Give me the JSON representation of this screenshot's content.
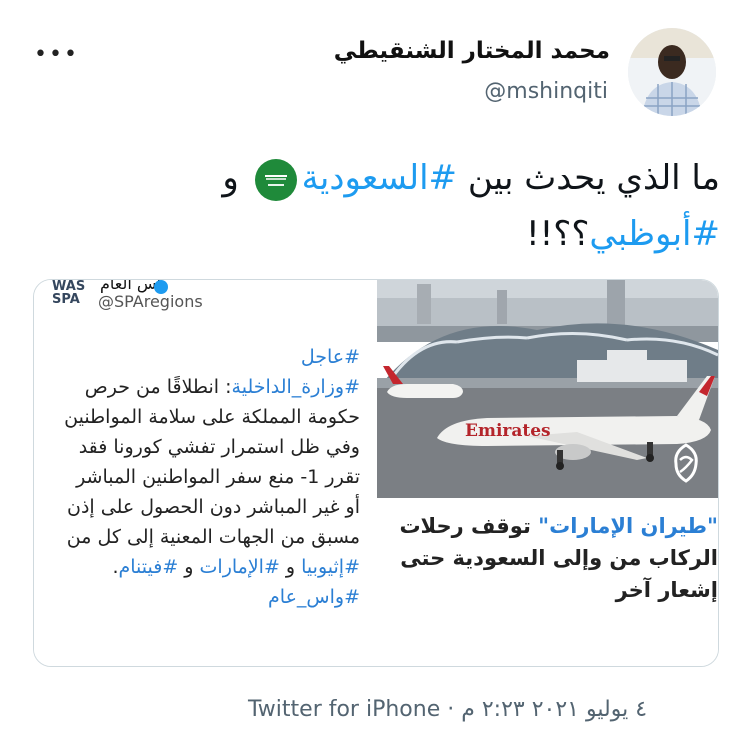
{
  "header": {
    "display_name": "محمد المختار الشنقيطي",
    "handle": "@mshinqiti",
    "more_label": "•••"
  },
  "tweet": {
    "text_before": "ما الذي يحدث بين ",
    "hashtag_saudi": "#السعودية",
    "text_and": " و",
    "hashtag_abudhabi": "#أبوظبي",
    "text_end": "؟؟!!"
  },
  "card": {
    "spa": {
      "logo_top": "WAS",
      "logo_bottom": "SPA",
      "account_name": "واس العام",
      "handle": "@SPAregions",
      "hashtag_urgent": "#عاجل",
      "hashtag_ministry": "#وزارة_الداخلية",
      "body_1": ": انطلاقًا من حرص حكومة المملكة على سلامة المواطنين وفي ظل استمرار تفشي كورونا فقد تقرر 1- منع سفر المواطنين المباشر أو غير المباشر دون الحصول على إذن مسبق من الجهات المعنية إلى كل من ",
      "hashtag_ethiopia": "#إثيوبيا",
      "and_1": " و ",
      "hashtag_uae": "#الإمارات",
      "and_2": " و ",
      "hashtag_vietnam": "#فيتنام",
      "period": ".",
      "hashtag_spa": "#واس_عام"
    },
    "news": {
      "quote_open": "\"طيران الإمارات\"",
      "headline_rest": " توقف رحلات الركاب من وإلى السعودية حتى إشعار آخر",
      "aircraft_livery": "Emirates",
      "channel_logo": "aljazeera-logo"
    }
  },
  "meta": {
    "time": "٢:٢٣ م",
    "separator": "·",
    "date": "٤ يوليو ٢٠٢١",
    "source": "Twitter for iPhone"
  },
  "colors": {
    "link": "#1d9bf0",
    "secondary_text": "#536471",
    "border": "#cfd9de"
  }
}
